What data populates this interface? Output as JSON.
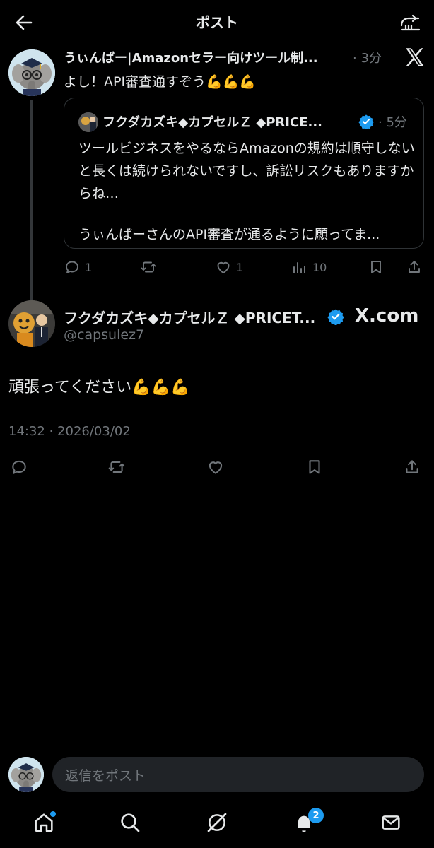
{
  "header": {
    "title": "ポスト"
  },
  "tweet1": {
    "display_name": "うぃんばー|Amazonセラー向けツール制...",
    "time": "· 3分",
    "text": "よし！API審査通すぞう",
    "emoji": "💪💪💪"
  },
  "quote": {
    "display_name": "フクダカズキ◆カプセルＺ ◆PRICE...",
    "time": "· 5分",
    "text_para1": "ツールビジネスをやるならAmazonの規約は順守しないと長くは続けられないですし、訴訟リスクもありますからね…",
    "text_para2": "うぃんばーさんのAPI審査が通るように願ってま..."
  },
  "tweet1_actions": {
    "replies": "1",
    "likes": "1",
    "views": "10"
  },
  "tweet2": {
    "display_name": "フクダカズキ◆カプセルＺ ◆PRICET...",
    "handle": "@capsulez7",
    "source_label": "X.com",
    "text": "頑張ってください",
    "emoji": "💪💪💪",
    "timestamp": "14:32 · 2026/03/02"
  },
  "reply_bar": {
    "placeholder": "返信をポスト"
  },
  "nav": {
    "notifications_badge": "2"
  },
  "colors": {
    "accent": "#1d9bf0",
    "muted": "#71767b",
    "background": "#000000"
  }
}
